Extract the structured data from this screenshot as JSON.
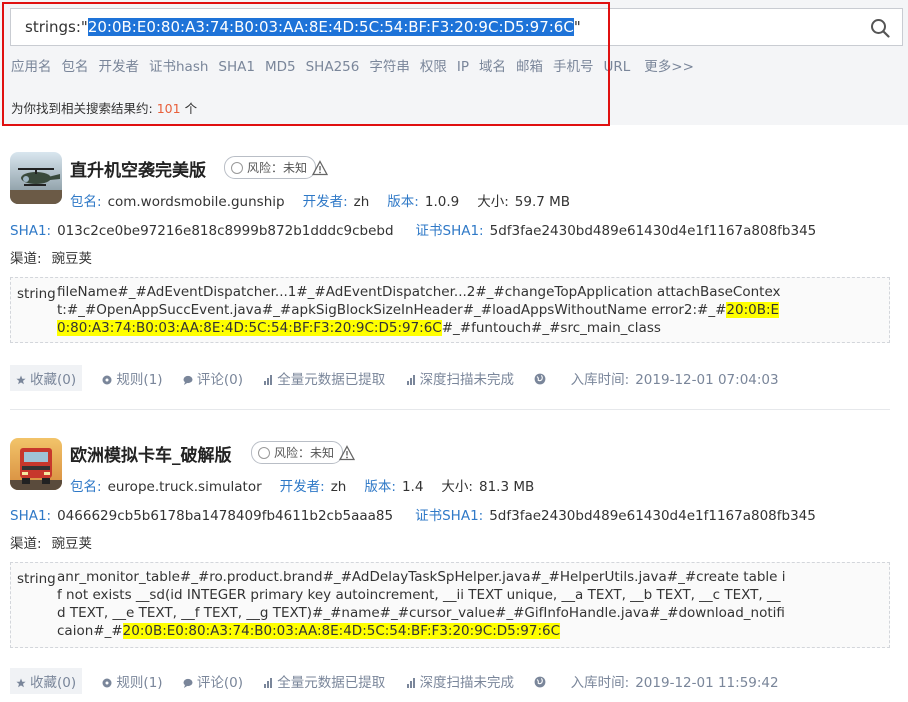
{
  "search": {
    "prefix": "strings:\"",
    "query": "20:0B:E0:80:A3:74:B0:03:AA:8E:4D:5C:54:BF:F3:20:9C:D5:97:6C",
    "suffix": "\""
  },
  "filter_tabs": [
    "应用名",
    "包名",
    "开发者",
    "证书hash",
    "SHA1",
    "MD5",
    "SHA256",
    "字符串",
    "权限",
    "IP",
    "域名",
    "邮箱",
    "手机号",
    "URL",
    "更多>>"
  ],
  "result": {
    "prefix": "为你找到相关搜索结果约:",
    "count": "101",
    "suffix": "个"
  },
  "labels": {
    "package": "包名:",
    "developer": "开发者:",
    "version": "版本:",
    "size": "大小:",
    "sha1": "SHA1:",
    "cert_sha1": "证书SHA1:",
    "channel": "渠道:",
    "string": "string",
    "risk": "风险：未知",
    "collect": "收藏(0)",
    "rules": "规则(1)",
    "comments": "评论(0)",
    "metadata": "全量元数据已提取",
    "deep_scan": "深度扫描未完成",
    "ingest_time": "入库时间:"
  },
  "apps": [
    {
      "name": "直升机空袭完美版",
      "package": "com.wordsmobile.gunship",
      "developer": "zh",
      "version": "1.0.9",
      "size": "59.7 MB",
      "sha1": "013c2ce0be97216e818c8999b872b1dddc9cbebd",
      "cert_sha1": "5df3fae2430bd489e61430d4e1f1167a808fb345",
      "channel": "豌豆荚",
      "string_before": "fileName#_#AdEventDispatcher...1#_#AdEventDispatcher...2#_#changeTopApplication attachBaseContext:#_#OpenAppSuccEvent.java#_#apkSigBlockSizeInHeader#_#loadAppsWithoutName error2:#_#",
      "string_match": "20:0B:E0:80:A3:74:B0:03:AA:8E:4D:5C:54:BF:F3:20:9C:D5:97:6C",
      "string_after": "#_#funtouch#_#src_main_class",
      "time": "2019-12-01 07:04:03"
    },
    {
      "name": "欧洲模拟卡车_破解版",
      "package": "europe.truck.simulator",
      "developer": "zh",
      "version": "1.4",
      "size": "81.3 MB",
      "sha1": "0466629cb5b6178ba1478409fb4611b2cb5aaa85",
      "cert_sha1": "5df3fae2430bd489e61430d4e1f1167a808fb345",
      "channel": "豌豆荚",
      "string_before": "anr_monitor_table#_#ro.product.brand#_#AdDelayTaskSpHelper.java#_#HelperUtils.java#_#create table if not exists __sd(id INTEGER primary key autoincrement, __ii TEXT unique, __a TEXT, __b TEXT, __c TEXT, __d TEXT, __e TEXT, __f TEXT, __g TEXT)#_#name#_#cursor_value#_#GifInfoHandle.java#_#download_notificaion#_#",
      "string_match": "20:0B:E0:80:A3:74:B0:03:AA:8E:4D:5C:54:BF:F3:20:9C:D5:97:6C",
      "string_after": "",
      "time": "2019-12-01 11:59:42"
    }
  ]
}
